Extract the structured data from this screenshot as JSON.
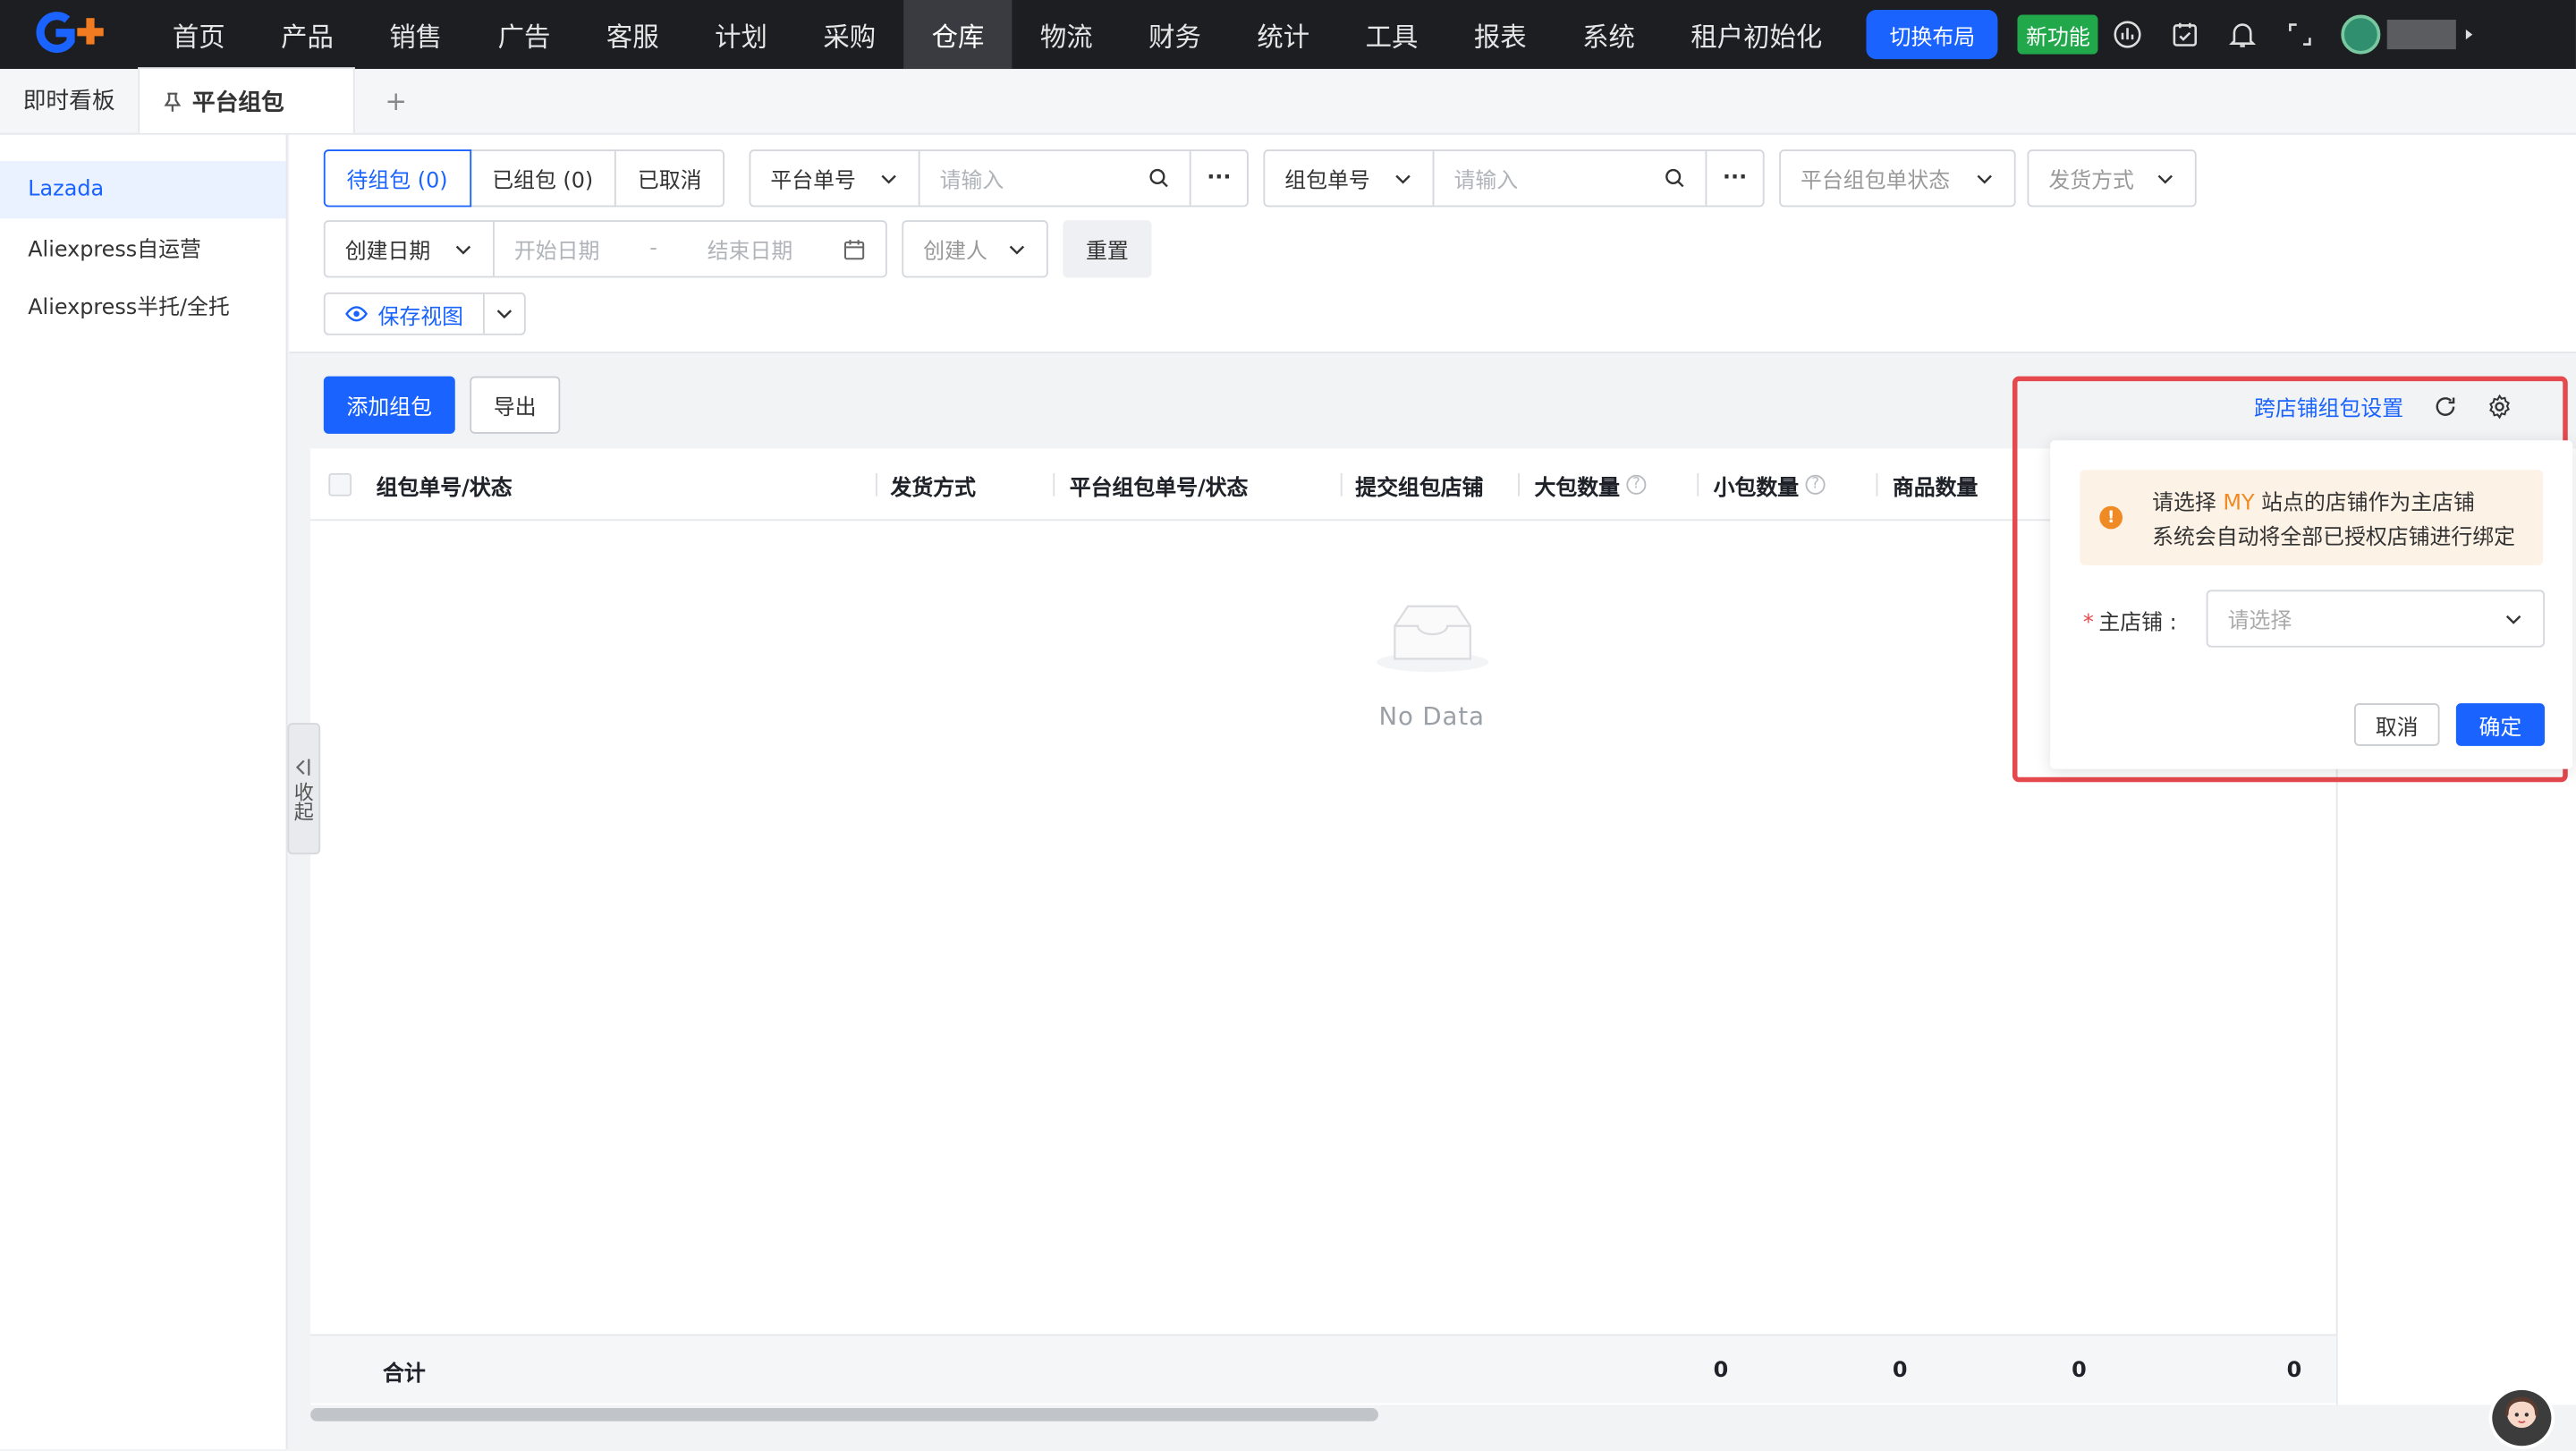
{
  "nav": {
    "items": [
      "首页",
      "产品",
      "销售",
      "广告",
      "客服",
      "计划",
      "采购",
      "仓库",
      "物流",
      "财务",
      "统计",
      "工具",
      "报表",
      "系统",
      "租户初始化"
    ],
    "active": "仓库",
    "switch_layout": "切换布局",
    "new_feature": "新功能",
    "accent": "#1a63ff"
  },
  "tabs": {
    "items": [
      "即时看板",
      "平台组包"
    ],
    "add": "+"
  },
  "sidebar": {
    "items": [
      "Lazada",
      "Aliexpress自运营",
      "Aliexpress半托/全托"
    ],
    "collapse_label": "收起"
  },
  "filters": {
    "status_tabs": [
      "待组包 (0)",
      "已组包 (0)",
      "已取消"
    ],
    "platform_no": {
      "label": "平台单号",
      "placeholder": "请输入"
    },
    "package_no": {
      "label": "组包单号",
      "placeholder": "请输入"
    },
    "platform_status": "平台组包单状态",
    "ship_method": "发货方式",
    "date_field": "创建日期",
    "start_date": "开始日期",
    "date_sep": "-",
    "end_date": "结束日期",
    "creator": "创建人",
    "reset": "重置",
    "save_view": "保存视图"
  },
  "toolbar": {
    "add": "添加组包",
    "export": "导出",
    "cross_store": "跨店铺组包设置"
  },
  "table": {
    "columns": [
      "组包单号/状态",
      "发货方式",
      "平台组包单号/状态",
      "提交组包店铺",
      "大包数量",
      "小包数量",
      "商品数量"
    ],
    "help_mark": "?",
    "empty_text": "No Data",
    "footer_label": "合计",
    "footer_values": [
      "0",
      "0",
      "0",
      "0"
    ]
  },
  "popover": {
    "line1_a": "请选择",
    "line1_site": "MY",
    "line1_b": "站点的店铺作为主店铺",
    "line2": "系统会自动将全部已授权店铺进行绑定",
    "field_label": "主店铺 :",
    "required_mark": "*",
    "select_placeholder": "请选择",
    "cancel": "取消",
    "confirm": "确定",
    "alert_icon": "!"
  }
}
